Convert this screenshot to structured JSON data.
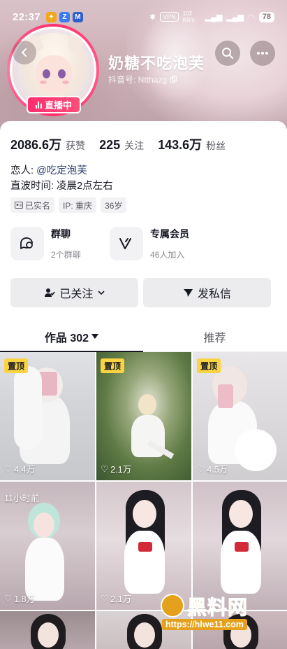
{
  "status_bar": {
    "time": "22:37",
    "signal_text": "102 KB/s",
    "vpn_label": "VPN",
    "battery": "78"
  },
  "profile": {
    "nickname": "奶糖不吃泡芙",
    "douyin_id": "抖音号: Ntthazg",
    "live_badge": "直播中"
  },
  "stats": [
    {
      "value": "2086.6万",
      "label": "获赞"
    },
    {
      "value": "225",
      "label": "关注"
    },
    {
      "value": "143.6万",
      "label": "粉丝"
    }
  ],
  "bio": {
    "lover_prefix": "恋人: ",
    "lover_mention": "@吃定泡芙",
    "line2": "直波时间:  凌晨2点左右"
  },
  "tags": [
    {
      "icon": "id-card-icon",
      "label": "已实名"
    },
    {
      "icon": "",
      "label": "IP: 重庆"
    },
    {
      "icon": "",
      "label": "36岁"
    }
  ],
  "features": {
    "group": {
      "title": "群聊",
      "sub": "2个群聊"
    },
    "member": {
      "title": "专属会员",
      "sub": "46人加入"
    }
  },
  "actions": {
    "followed_label": "已关注",
    "message_label": "发私信"
  },
  "tabs": {
    "works_label": "作品 302",
    "recommend_label": "推荐"
  },
  "grid": [
    {
      "badge": "置顶",
      "likes": "4.4万"
    },
    {
      "badge": "置顶",
      "likes": "2.1万"
    },
    {
      "badge": "置顶",
      "likes": "4.5万"
    },
    {
      "badge": "11小时前",
      "likes": "1.8万"
    },
    {
      "badge": "",
      "likes": "2.1万"
    },
    {
      "badge": "",
      "likes": ""
    },
    {
      "badge": "",
      "likes": ""
    },
    {
      "badge": "",
      "likes": ""
    },
    {
      "badge": "",
      "likes": ""
    }
  ],
  "watermark": {
    "title": "黑料网",
    "url": "https://hlwe11.com"
  },
  "colors": {
    "live": "#ff2d6e",
    "pin_badge": "#f9d342",
    "mention": "#2a3e6b",
    "watermark": "#f3ae1a"
  }
}
